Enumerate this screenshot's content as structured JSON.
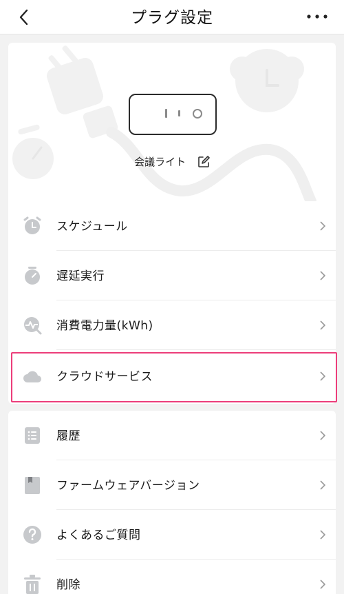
{
  "header": {
    "title": "プラグ設定",
    "back_icon": "chevron-left-icon",
    "more_icon": "more-horizontal-icon"
  },
  "device": {
    "name": "会議ライト",
    "edit_icon": "edit-icon"
  },
  "menu_top": [
    {
      "label": "スケジュール",
      "icon": "alarm-clock-icon"
    },
    {
      "label": "遅延実行",
      "icon": "timer-icon"
    },
    {
      "label": "消費電力量(kWh)",
      "icon": "activity-chart-icon"
    },
    {
      "label": "クラウドサービス",
      "icon": "cloud-icon"
    }
  ],
  "menu_bottom": [
    {
      "label": "履歴",
      "icon": "list-icon"
    },
    {
      "label": "ファームウェアバージョン",
      "icon": "book-icon"
    },
    {
      "label": "よくあるご質問",
      "icon": "help-icon"
    },
    {
      "label": "削除",
      "icon": "trash-icon"
    }
  ],
  "colors": {
    "highlight": "#ec3d7a",
    "icon_gray": "#c7c9cc",
    "text": "#1a1a1a"
  }
}
